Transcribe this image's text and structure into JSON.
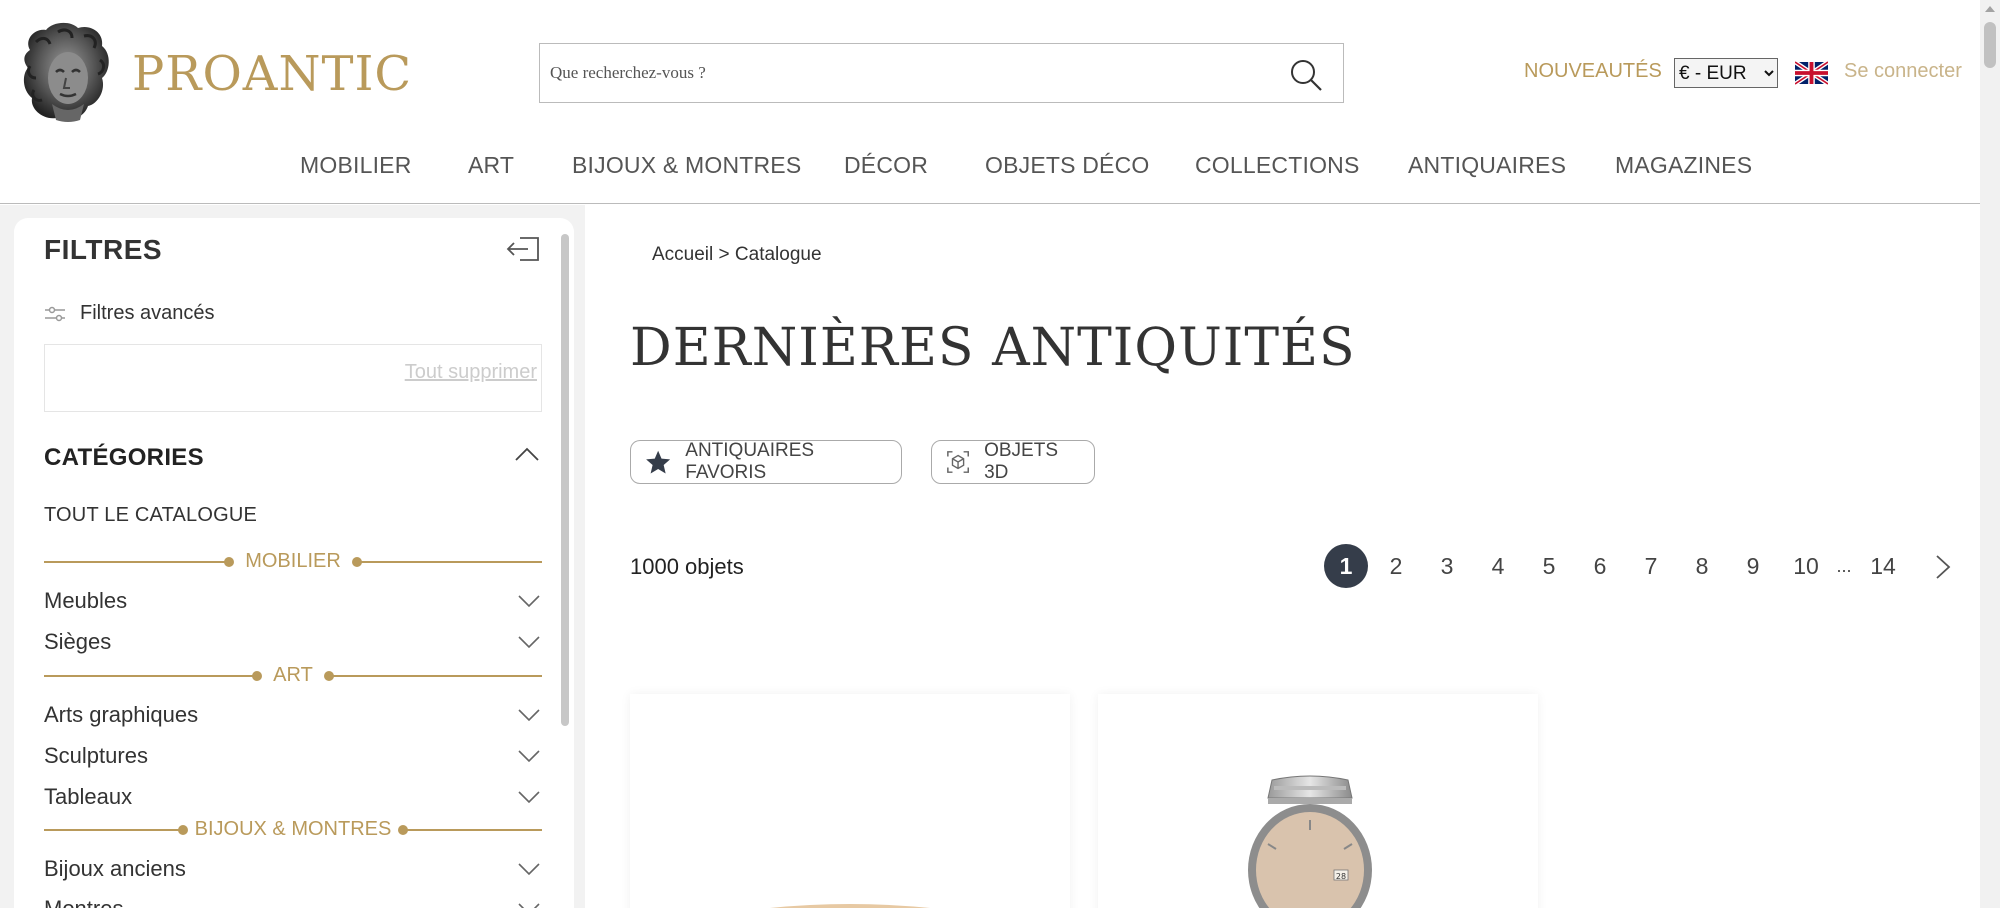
{
  "header": {
    "logo_text": "PROANTIC",
    "search_placeholder": "Que recherchez-vous ?",
    "nouveautes": "NOUVEAUTÉS",
    "currency": "€ - EUR",
    "connect": "Se connecter"
  },
  "nav": [
    "MOBILIER",
    "ART",
    "BIJOUX & MONTRES",
    "DÉCOR",
    "OBJETS DÉCO",
    "COLLECTIONS",
    "ANTIQUAIRES",
    "MAGAZINES"
  ],
  "sidebar": {
    "title": "FILTRES",
    "advanced": "Filtres avancés",
    "clear_all": "Tout supprimer",
    "categories_title": "CATÉGORIES",
    "all_catalogue": "TOUT LE CATALOGUE",
    "groups": [
      {
        "label": "MOBILIER",
        "items": [
          "Meubles",
          "Sièges"
        ]
      },
      {
        "label": "ART",
        "items": [
          "Arts graphiques",
          "Sculptures",
          "Tableaux"
        ]
      },
      {
        "label": "BIJOUX & MONTRES",
        "items": [
          "Bijoux anciens",
          "Montres"
        ]
      }
    ]
  },
  "main": {
    "breadcrumb_home": "Accueil",
    "breadcrumb_sep": ">",
    "breadcrumb_current": "Catalogue",
    "title": "DERNIÈRES ANTIQUITÉS",
    "chips": [
      "ANTIQUAIRES FAVORIS",
      "OBJETS 3D"
    ],
    "count": "1000 objets",
    "pages": [
      "1",
      "2",
      "3",
      "4",
      "5",
      "6",
      "7",
      "8",
      "9",
      "10",
      "...",
      "14"
    ],
    "current_page": "1"
  },
  "colors": {
    "gold": "#b99a5b",
    "dark": "#353d4a"
  }
}
